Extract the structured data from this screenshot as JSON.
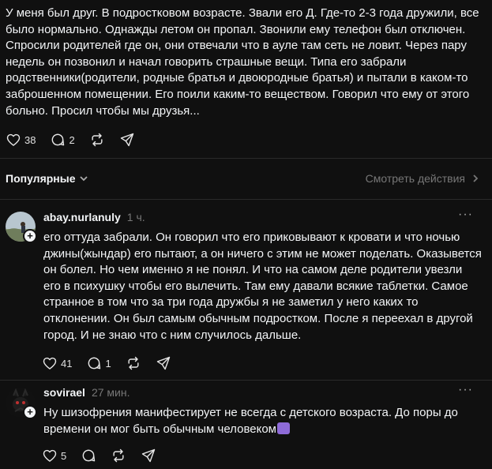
{
  "post": {
    "text": "У меня был друг. В подростковом возрасте. Звали его Д. Где-то 2-3 года дружили, все было нормально. Однажды летом он пропал. Звонили ему телефон был отключен. Спросили родителей где он, они отвечали что в ауле там сеть не ловит. Через пару недель он позвонил и начал говорить страшные вещи. Типа его забрали родственники(родители, родные братья и двоюродные братья) и пытали в каком-то заброшенном помещении. Его поили каким-то веществом. Говорил что ему от этого больно. Просил чтобы мы друзья...",
    "likes": "38",
    "replies": "2"
  },
  "sort": {
    "label": "Популярные",
    "view_actions": "Смотреть действия"
  },
  "comments": [
    {
      "username": "abay.nurlanuly",
      "time": "1 ч.",
      "text": "его оттуда забрали. Он говорил что его приковывают к кровати и что ночью джины(жындар) его пытают, а он ничего с этим не может поделать. Оказывется он болел. Но чем именно я не понял. И что на самом деле родители увезли его в психушку чтобы его вылечить. Там ему давали всякие таблетки. Самое странное в том что за три года дружбы я не заметил у него каких то отклонении. Он был самым обычным подростком. После я переехал в другой город. И не знаю что с ним случилось дальше.",
      "likes": "41",
      "replies": "1"
    },
    {
      "username": "sovirael",
      "time": "27 мин.",
      "text": "Ну шизофрения манифестирует не всегда с детского возраста. До поры до времени он мог быть обычным человеком",
      "likes": "5",
      "replies": ""
    }
  ],
  "icons": {
    "like": "heart-icon",
    "reply": "comment-icon",
    "repost": "repost-icon",
    "share": "share-icon",
    "more": "more-icon"
  }
}
